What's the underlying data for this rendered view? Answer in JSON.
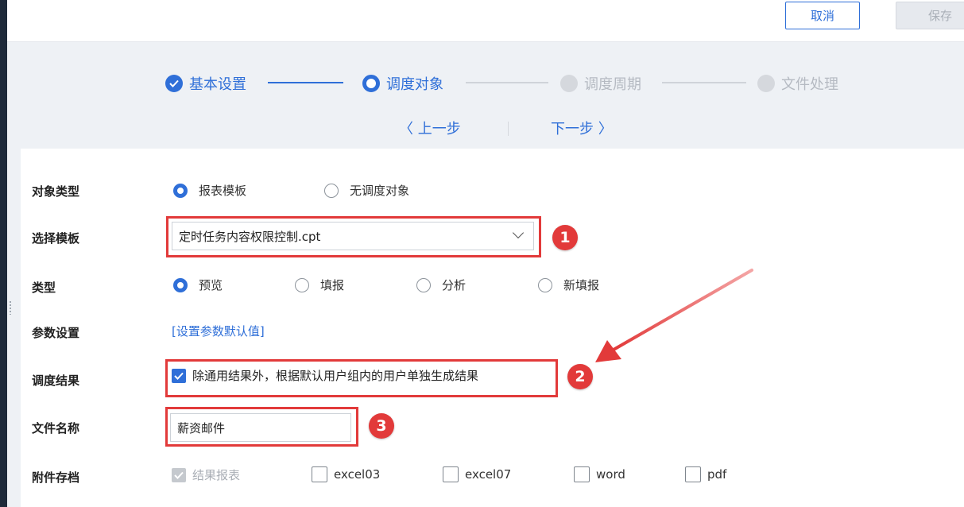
{
  "toolbar": {
    "cancel_label": "取消",
    "save_label": "保存"
  },
  "stepper": {
    "steps": [
      {
        "label": "基本设置",
        "state": "done"
      },
      {
        "label": "调度对象",
        "state": "current"
      },
      {
        "label": "调度周期",
        "state": "future"
      },
      {
        "label": "文件处理",
        "state": "future"
      }
    ]
  },
  "nav": {
    "prev_label": "〈 上一步",
    "next_label": "下一步 〉"
  },
  "form": {
    "object_type": {
      "label": "对象类型",
      "options": [
        "报表模板",
        "无调度对象"
      ],
      "selected": "报表模板"
    },
    "template": {
      "label": "选择模板",
      "value": "定时任务内容权限控制.cpt"
    },
    "type": {
      "label": "类型",
      "options": [
        "预览",
        "填报",
        "分析",
        "新填报"
      ],
      "selected": "预览"
    },
    "params": {
      "label": "参数设置",
      "link_text": "[设置参数默认值]"
    },
    "schedule_result": {
      "label": "调度结果",
      "checkbox_text": "除通用结果外，根据默认用户组内的用户单独生成结果",
      "checked": true
    },
    "file_name": {
      "label": "文件名称",
      "value": "薪资邮件"
    },
    "attachments": {
      "label": "附件存档",
      "options": [
        {
          "label": "结果报表",
          "checked": true,
          "disabled": true
        },
        {
          "label": "excel03",
          "checked": false
        },
        {
          "label": "excel07",
          "checked": false
        },
        {
          "label": "word",
          "checked": false
        },
        {
          "label": "pdf",
          "checked": false
        }
      ]
    }
  },
  "annotations": {
    "badges": [
      "1",
      "2",
      "3"
    ],
    "color": "#e23a3a"
  },
  "colors": {
    "accent": "#2f6fd8",
    "inactive": "#d5d8dd"
  }
}
